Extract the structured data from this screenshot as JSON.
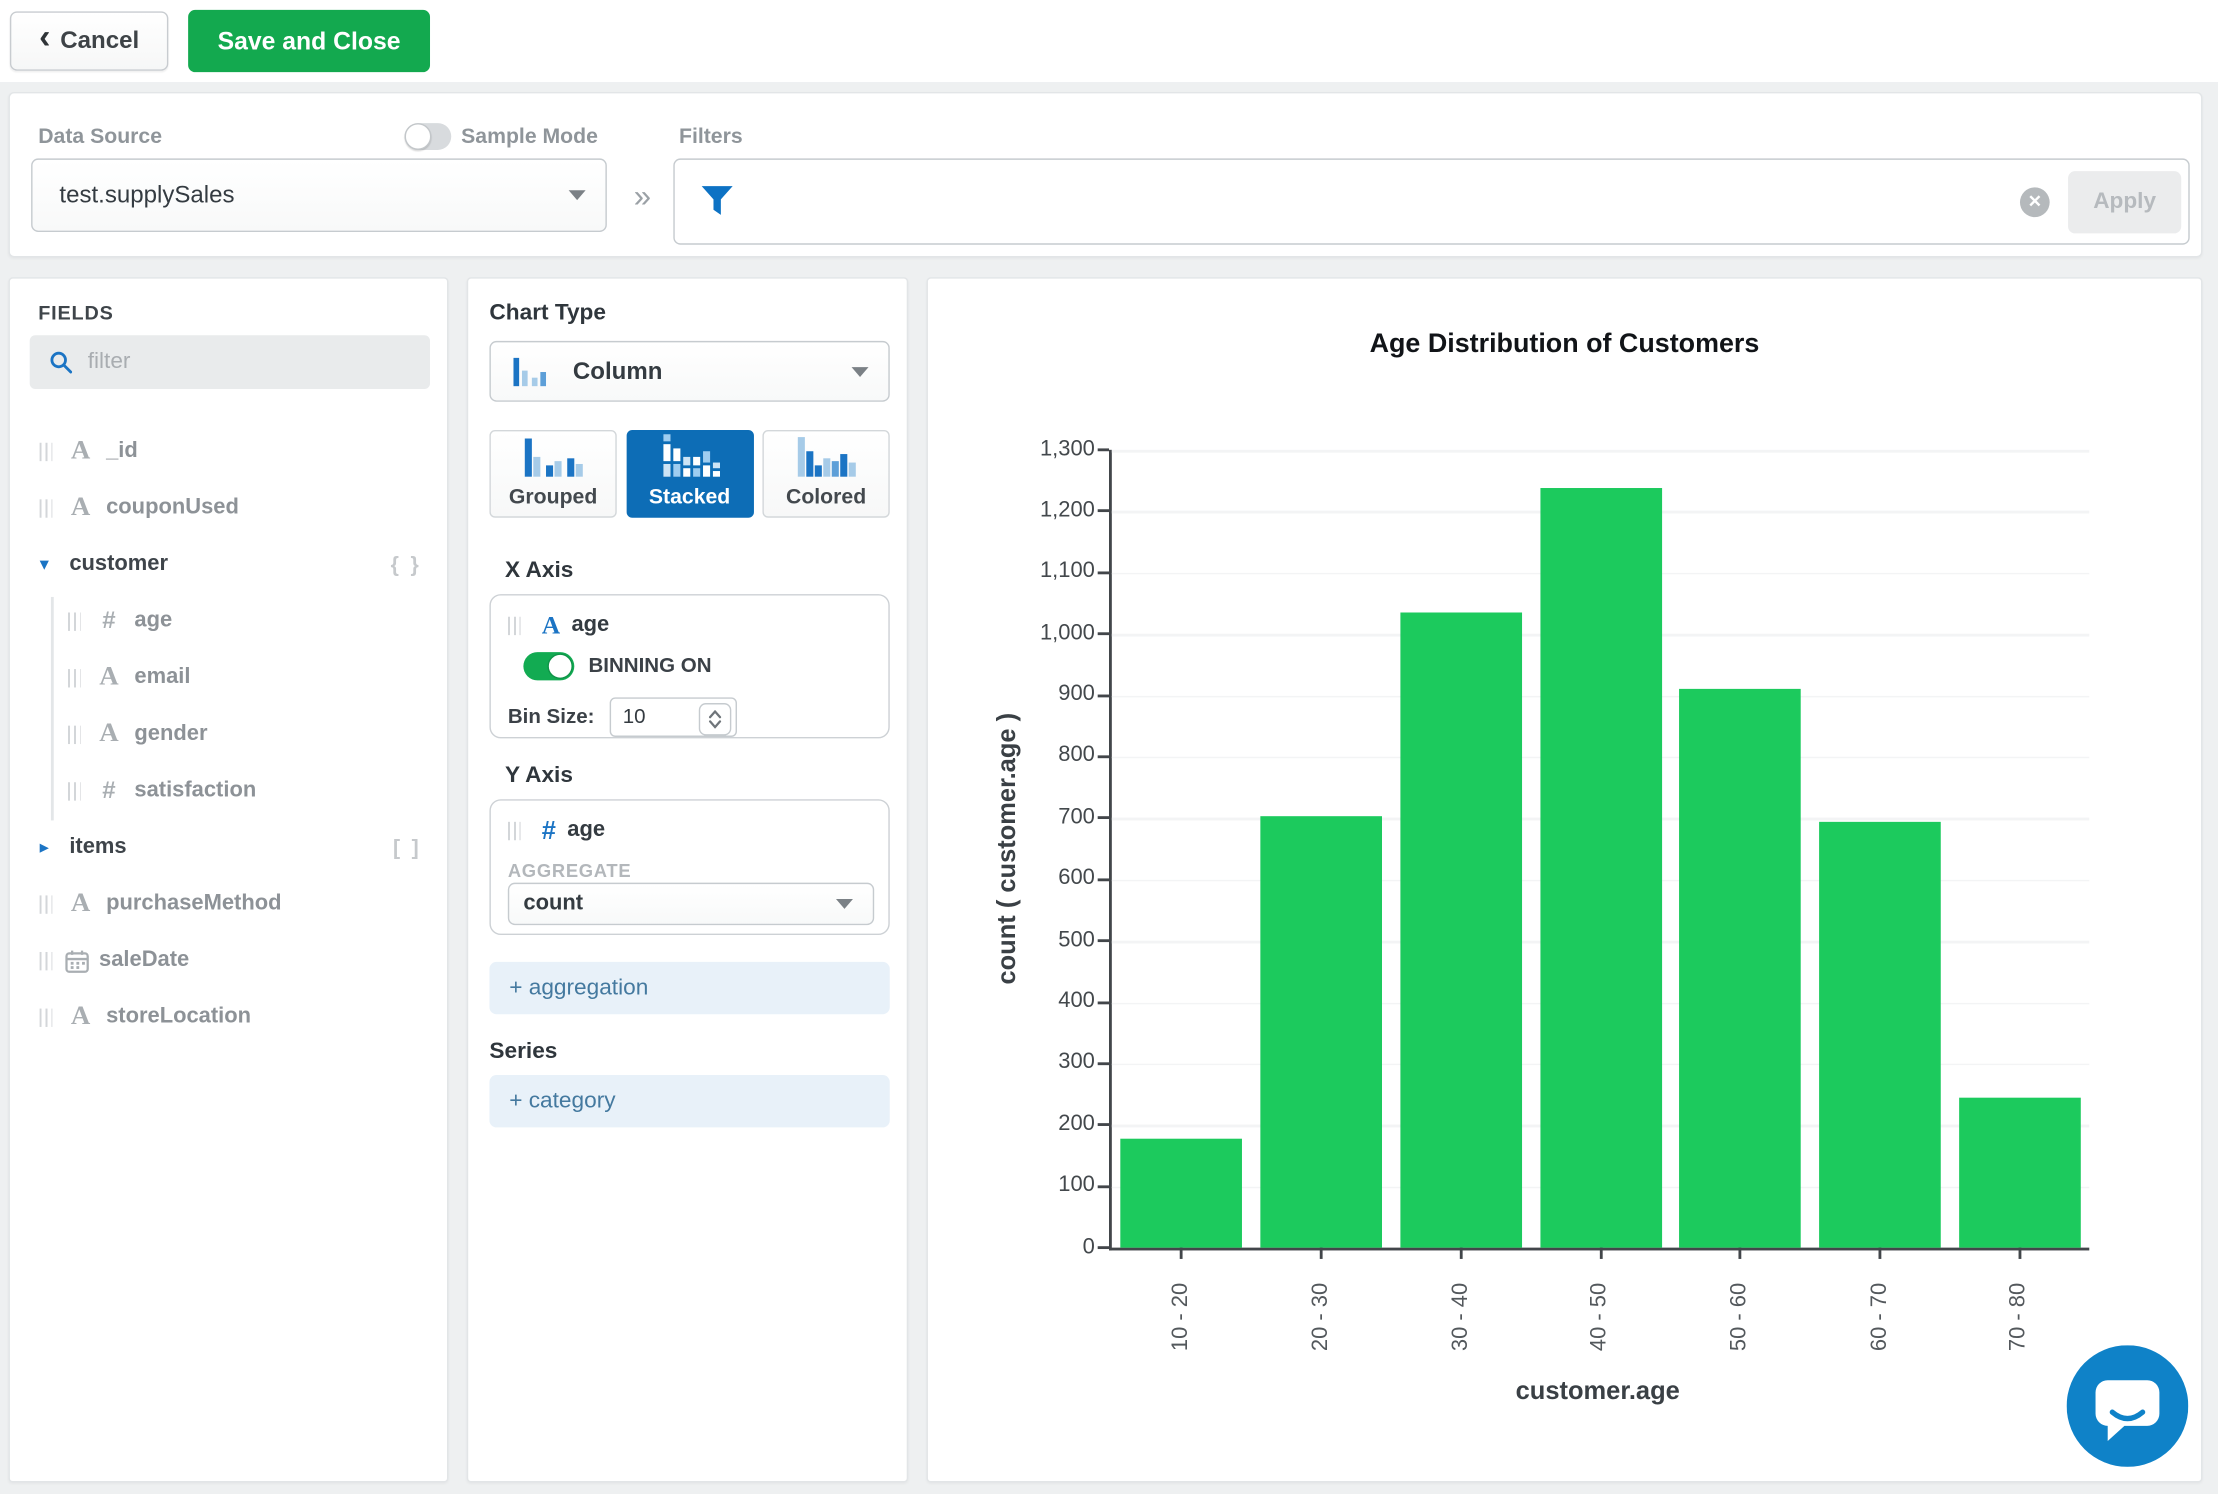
{
  "toolbar": {
    "cancel_label": "Cancel",
    "save_label": "Save and Close"
  },
  "datasource": {
    "label": "Data Source",
    "value": "test.supplySales",
    "sample_mode_label": "Sample Mode",
    "filters_label": "Filters",
    "apply_label": "Apply"
  },
  "fields": {
    "title": "FIELDS",
    "filter_placeholder": "filter",
    "items": [
      {
        "name": "_id",
        "type": "string",
        "indent": 0
      },
      {
        "name": "couponUsed",
        "type": "string",
        "indent": 0
      },
      {
        "name": "customer",
        "type": "object",
        "indent": 0,
        "expanded": true,
        "badge": "{ }"
      },
      {
        "name": "age",
        "type": "number",
        "indent": 1
      },
      {
        "name": "email",
        "type": "string",
        "indent": 1
      },
      {
        "name": "gender",
        "type": "string",
        "indent": 1
      },
      {
        "name": "satisfaction",
        "type": "number",
        "indent": 1
      },
      {
        "name": "items",
        "type": "array",
        "indent": 0,
        "expanded": false,
        "badge": "[ ]"
      },
      {
        "name": "purchaseMethod",
        "type": "string",
        "indent": 0
      },
      {
        "name": "saleDate",
        "type": "date",
        "indent": 0
      },
      {
        "name": "storeLocation",
        "type": "string",
        "indent": 0
      }
    ]
  },
  "encoding": {
    "chart_type_label": "Chart Type",
    "chart_type_value": "Column",
    "variants": [
      {
        "label": "Grouped",
        "selected": false,
        "icon": "grouped-bars-icon"
      },
      {
        "label": "Stacked",
        "selected": true,
        "icon": "stacked-bars-icon"
      },
      {
        "label": "Colored",
        "selected": false,
        "icon": "colored-bars-icon"
      }
    ],
    "x_axis": {
      "label": "X Axis",
      "field": "age",
      "field_type": "string",
      "binning_label": "BINNING ON",
      "bin_size_label": "Bin Size:",
      "bin_size_value": "10"
    },
    "y_axis": {
      "label": "Y Axis",
      "field": "age",
      "field_type": "number",
      "aggregate_label": "AGGREGATE",
      "aggregate_value": "count"
    },
    "add_aggregation_label": "+ aggregation",
    "series_label": "Series",
    "add_category_label": "+ category"
  },
  "chart_data": {
    "type": "bar",
    "title": "Age Distribution of Customers",
    "categories": [
      "10 - 20",
      "20 - 30",
      "30 - 40",
      "40 - 50",
      "50 - 60",
      "60 - 70",
      "70 - 80"
    ],
    "values": [
      178,
      703,
      1036,
      1239,
      910,
      695,
      245
    ],
    "xlabel": "customer.age",
    "ylabel": "count ( customer.age )",
    "ylim": [
      0,
      1300
    ],
    "ytick_step": 100,
    "grid": true,
    "legend": false,
    "bar_color": "#1cca5d"
  },
  "colors": {
    "brand_green": "#13a94f",
    "bar_green": "#1cca5d",
    "selected_blue": "#0d6db6",
    "icon_blue": "#1b74c4",
    "page_bg": "#eef0f1"
  }
}
